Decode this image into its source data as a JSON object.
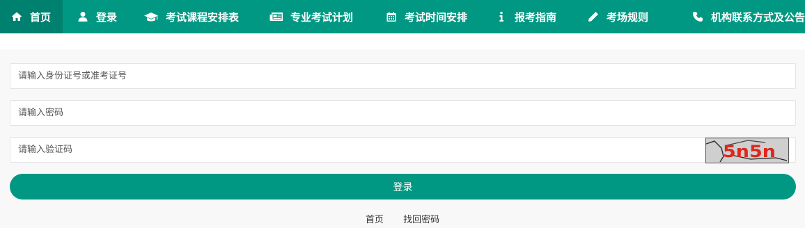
{
  "nav": {
    "items": [
      {
        "label": "首页",
        "icon": "home-icon"
      },
      {
        "label": "登录",
        "icon": "user-icon"
      },
      {
        "label": "考试课程安排表",
        "icon": "graduation-cap-icon"
      },
      {
        "label": "专业考试计划",
        "icon": "newspaper-icon"
      },
      {
        "label": "考试时间安排",
        "icon": "calendar-icon"
      },
      {
        "label": "报考指南",
        "icon": "info-icon"
      },
      {
        "label": "考场规则",
        "icon": "pencil-icon"
      },
      {
        "label": "机构联系方式及公告",
        "icon": "phone-icon"
      }
    ],
    "active_index": 0,
    "background": "#009882"
  },
  "form": {
    "id_placeholder": "请输入身份证号或准考证号",
    "password_placeholder": "请输入密码",
    "captcha_placeholder": "请输入验证码",
    "captcha_text": "5n5n",
    "submit_label": "登录"
  },
  "links": {
    "home": "首页",
    "recover_password": "找回密码"
  },
  "colors": {
    "accent": "#009882",
    "captcha_text": "#e0261b"
  }
}
